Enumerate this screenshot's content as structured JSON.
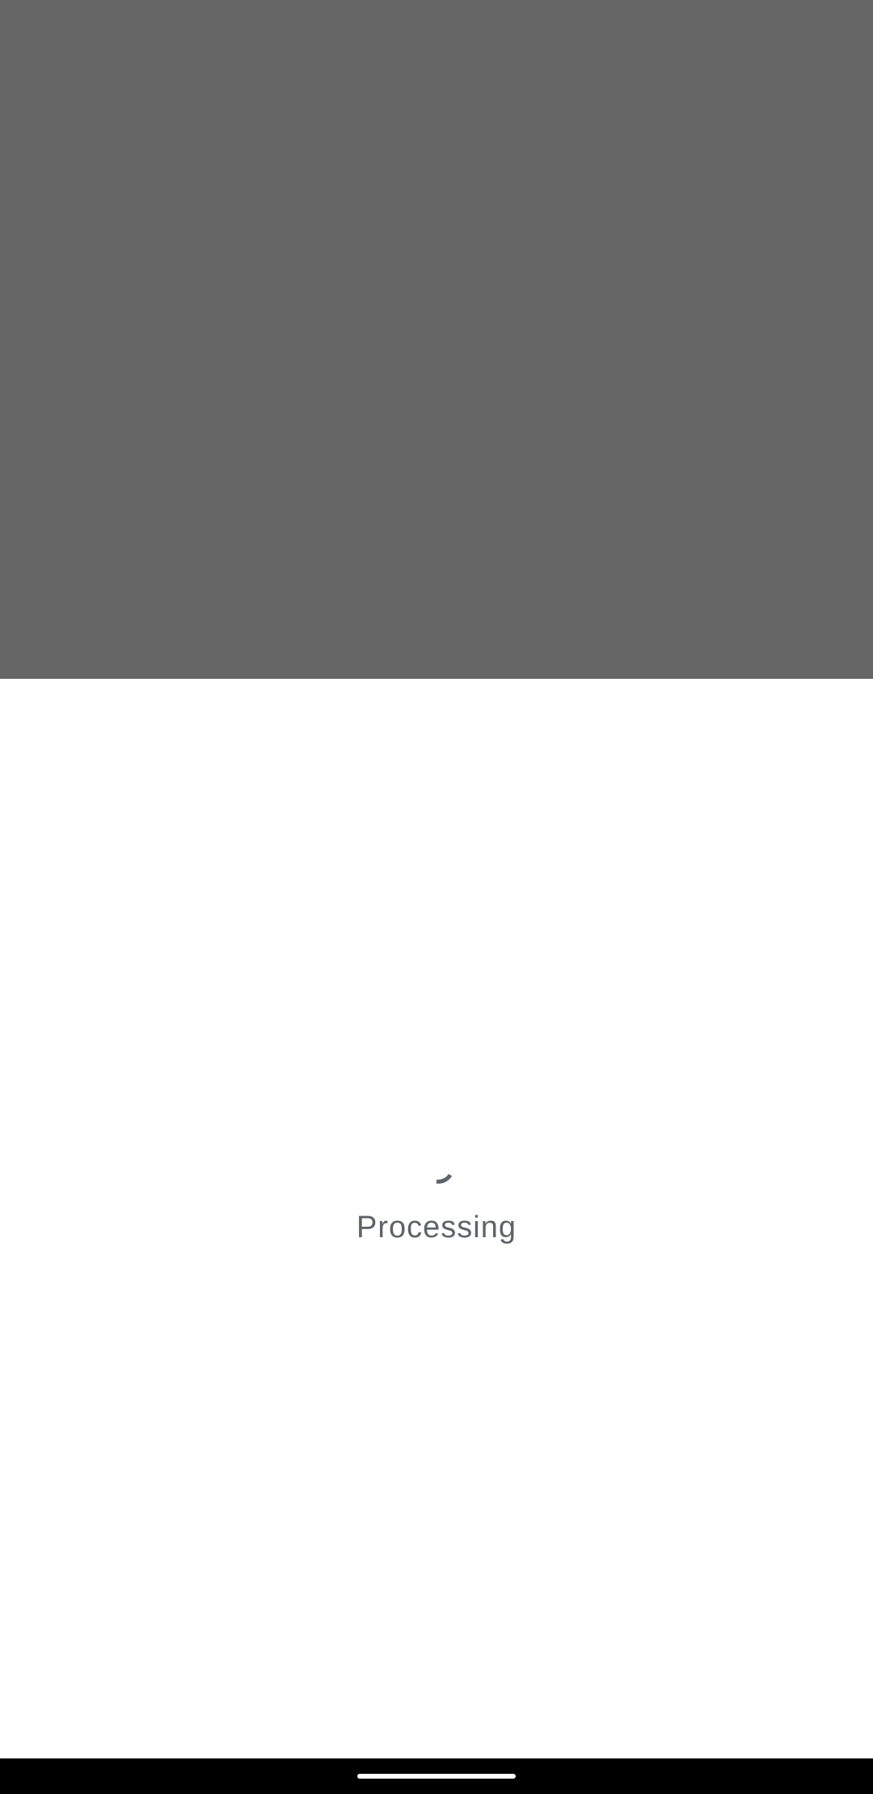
{
  "loading": {
    "status_text": "Processing",
    "progress_icon": "spinner-icon"
  },
  "colors": {
    "scrim": "#666666",
    "sheet": "#ffffff",
    "text": "#5f6368",
    "spinner": "#5f6368",
    "nav_bar": "#000000",
    "home_handle": "#ffffff"
  }
}
